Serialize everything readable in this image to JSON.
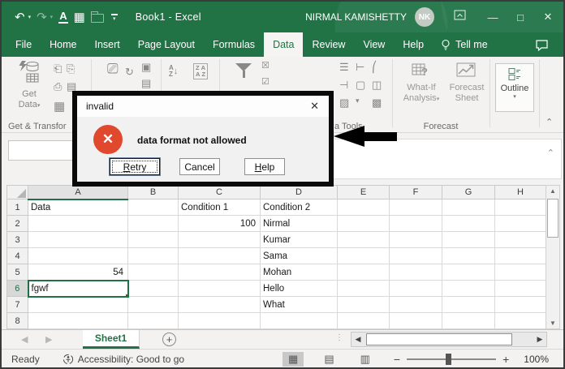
{
  "title_bar": {
    "document_title": "Book1 - Excel",
    "user_name": "NIRMAL KAMISHETTY",
    "user_initials": "NK"
  },
  "menu": {
    "tabs": [
      "File",
      "Home",
      "Insert",
      "Page Layout",
      "Formulas",
      "Data",
      "Review",
      "View",
      "Help"
    ],
    "active_tab": "Data",
    "tell_me_label": "Tell me"
  },
  "ribbon": {
    "get_data_line1": "Get",
    "get_data_line2": "Data",
    "group_labels": {
      "get_transform": "Get & Transfor",
      "data_tools": "a Tools",
      "forecast": "Forecast"
    },
    "what_if_line1": "What-If",
    "what_if_line2": "Analysis",
    "forecast_sheet_line1": "Forecast",
    "forecast_sheet_line2": "Sheet",
    "outline_label": "Outline"
  },
  "dialog": {
    "title": "invalid",
    "message": "data format not allowed",
    "retry_label": "Retry",
    "cancel_label": "Cancel",
    "help_label": "Help"
  },
  "grid": {
    "columns": [
      "A",
      "B",
      "C",
      "D",
      "E",
      "F",
      "G",
      "H"
    ],
    "row_numbers": [
      "1",
      "2",
      "3",
      "4",
      "5",
      "6",
      "7",
      "8"
    ],
    "cells": {
      "A1": "Data",
      "C1": "Condition 1",
      "D1": "Condition 2",
      "C2": "100",
      "D2": "Nirmal",
      "D3": "Kumar",
      "D4": "Sama",
      "A5": "54",
      "D5": "Mohan",
      "A6": "fgwf",
      "D6": "Hello",
      "D7": "What"
    },
    "active_cell": "A6",
    "active_column": "A",
    "active_row": "6",
    "right_aligned": [
      "C2",
      "A5"
    ]
  },
  "sheet_tabs": {
    "sheet1_label": "Sheet1"
  },
  "status_bar": {
    "ready_label": "Ready",
    "accessibility_label": "Accessibility: Good to go",
    "zoom_level": "100%"
  },
  "colors": {
    "excel_green": "#217346",
    "error_red": "#e0492d"
  }
}
